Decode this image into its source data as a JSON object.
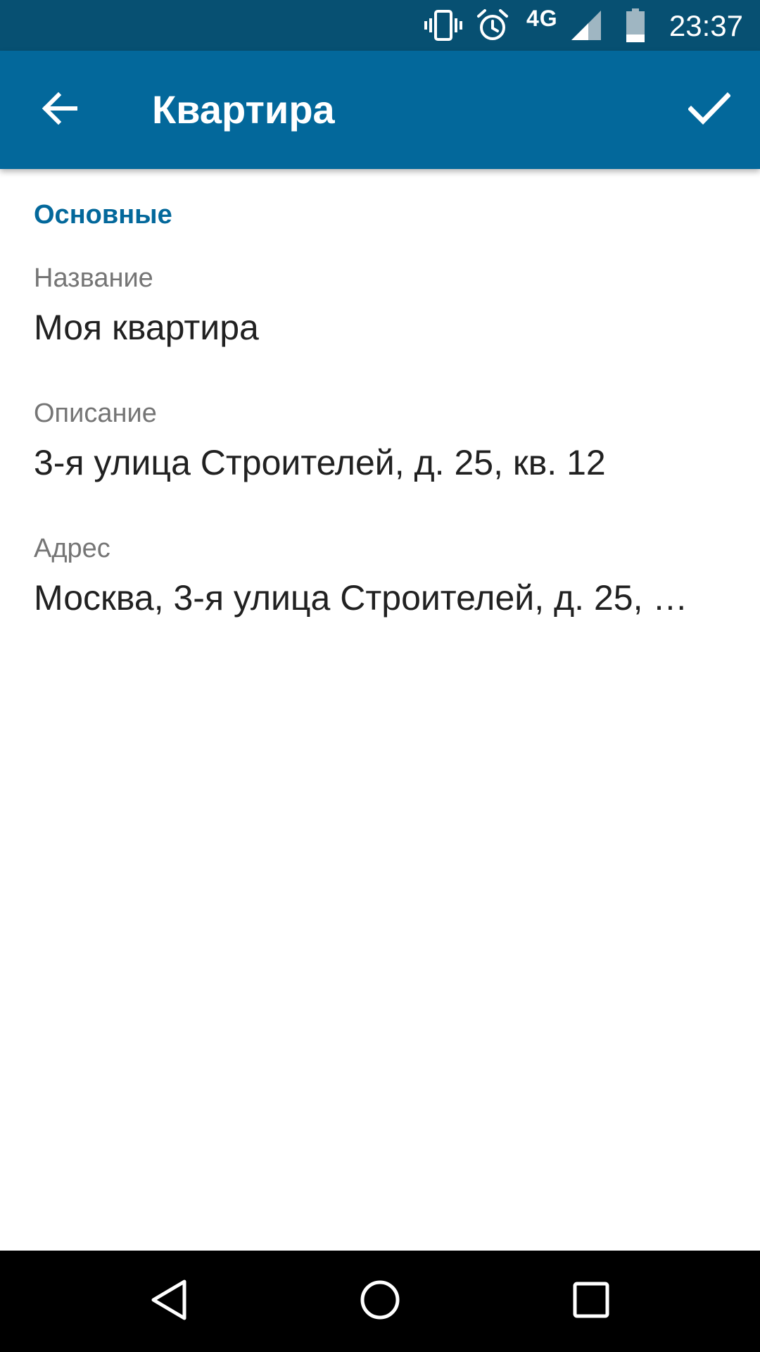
{
  "status_bar": {
    "network": "4G",
    "time": "23:37",
    "icons": [
      "vibrate-icon",
      "alarm-icon",
      "signal-icon",
      "battery-icon"
    ]
  },
  "app_bar": {
    "title": "Квартира",
    "back_icon": "arrow-back-icon",
    "confirm_icon": "check-icon",
    "background": "#03689B",
    "status_background": "#075072"
  },
  "section": {
    "header": "Основные",
    "accent": "#03689B"
  },
  "fields": [
    {
      "title": "Название",
      "summary": "Моя квартира"
    },
    {
      "title": "Описание",
      "summary": "3-я улица Строителей, д. 25, кв. 12"
    },
    {
      "title": "Адрес",
      "summary": "Москва, 3-я улица Строителей, д. 25, …"
    }
  ],
  "nav_bar": {
    "icons": [
      "nav-back-icon",
      "nav-home-icon",
      "nav-recents-icon"
    ]
  }
}
